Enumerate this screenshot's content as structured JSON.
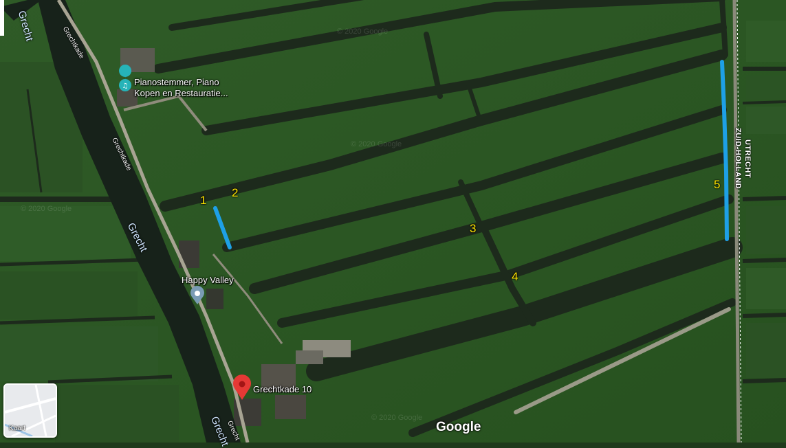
{
  "map": {
    "places": [
      {
        "name_line1": "Pianostemmer, Piano",
        "name_line2": "Kopen en Restauratie..."
      },
      {
        "name_line1": "Happy Valley"
      }
    ],
    "pin": {
      "label": "Grechtkade 10"
    },
    "roads": [
      "Grechtkade",
      "Grechtkade",
      "Grecht"
    ],
    "water": [
      "Grecht",
      "Grecht",
      "Grecht"
    ],
    "border": {
      "east": "UTRECHT",
      "west": "ZUID-HOLLAND"
    },
    "markers": [
      "1",
      "2",
      "3",
      "4",
      "5"
    ],
    "watermark": "© 2020 Google",
    "layer_toggle": {
      "label": "Kaart"
    },
    "logo": "Google",
    "colors": {
      "field": "#2e5a26",
      "ditch": "#1d2a1c",
      "canal": "#17221a",
      "road": "#a8a493",
      "highlight": "#1ea0e6",
      "marker_text": "#ffe600",
      "pin": "#e53935"
    }
  }
}
